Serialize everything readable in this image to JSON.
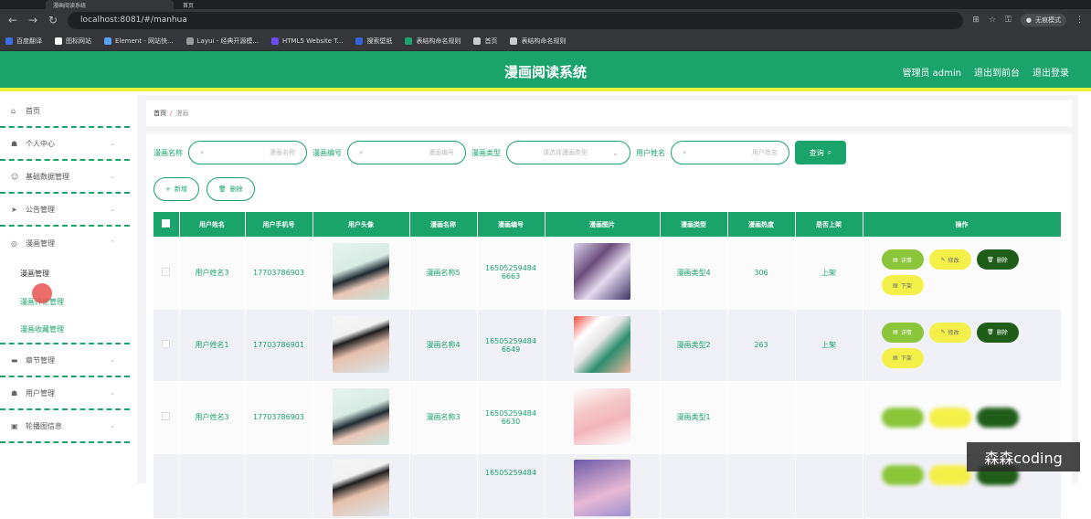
{
  "browser": {
    "tabs": [
      {
        "label": "漫画阅读系统"
      },
      {
        "label": "首页"
      }
    ],
    "url": "localhost:8081/#/manhua",
    "incognito_label": "无痕模式",
    "bookmarks": [
      {
        "label": "百度翻译",
        "color": "#3b6fe0"
      },
      {
        "label": "图标网站",
        "color": "#ffffff"
      },
      {
        "label": "Element - 网站快...",
        "color": "#5aa0f2"
      },
      {
        "label": "Layui - 经典开源模...",
        "color": "#999999"
      },
      {
        "label": "HTML5 Website T...",
        "color": "#6a4df2"
      },
      {
        "label": "搜索壁纸",
        "color": "#3563d8"
      },
      {
        "label": "表结构命名规则",
        "color": "#1aa36b"
      },
      {
        "label": "首页",
        "color": "#cccccc"
      },
      {
        "label": "表结构命名规则",
        "color": "#cccccc"
      }
    ]
  },
  "header": {
    "title": "漫画阅读系统",
    "admin_label": "管理员 admin",
    "backend_link": "退出到前台",
    "logout_link": "退出登录"
  },
  "sidebar": {
    "items": [
      {
        "label": "首页",
        "icon": "home-icon"
      },
      {
        "label": "个人中心",
        "icon": "user-icon"
      },
      {
        "label": "基础数据管理",
        "icon": "smile-icon"
      },
      {
        "label": "公告管理",
        "icon": "send-icon"
      },
      {
        "label": "漫画管理",
        "icon": "compass-icon"
      }
    ],
    "sub_items": [
      {
        "label": "漫画管理"
      },
      {
        "label": "漫画评论管理"
      },
      {
        "label": "漫画收藏管理"
      }
    ],
    "items_after": [
      {
        "label": "章节管理",
        "icon": "folder-icon"
      },
      {
        "label": "用户管理",
        "icon": "user-icon"
      },
      {
        "label": "轮播图信息",
        "icon": "image-icon"
      }
    ]
  },
  "breadcrumb": {
    "home": "首页",
    "separator": "/",
    "current": "漫画"
  },
  "search": {
    "name_label": "漫画名称",
    "name_placeholder": "漫画名称",
    "number_label": "漫画编号",
    "number_placeholder": "漫画编号",
    "type_label": "漫画类型",
    "type_placeholder": "请选择漫画类型",
    "user_label": "用户姓名",
    "user_placeholder": "用户姓名",
    "search_button": "查询"
  },
  "actions": {
    "add_button": "新增",
    "delete_button": "删除"
  },
  "table": {
    "columns": [
      "用户姓名",
      "用户手机号",
      "用户头像",
      "漫画名称",
      "漫画编号",
      "漫画图片",
      "漫画类型",
      "漫画热度",
      "是否上架",
      "操作"
    ],
    "rows": [
      {
        "user": "用户姓名3",
        "phone": "17703786903",
        "name": "漫画名称5",
        "number": "165052594846663",
        "type": "漫画类型4",
        "heat": "306",
        "status": "上架"
      },
      {
        "user": "用户姓名1",
        "phone": "17703786901",
        "name": "漫画名称4",
        "number": "165052594846649",
        "type": "漫画类型2",
        "heat": "263",
        "status": "上架"
      },
      {
        "user": "用户姓名3",
        "phone": "17703786903",
        "name": "漫画名称3",
        "number": "165052594846630",
        "type": "漫画类型1",
        "heat": "",
        "status": ""
      },
      {
        "user": "",
        "phone": "",
        "name": "",
        "number": "16505259484",
        "type": "",
        "heat": "",
        "status": ""
      }
    ],
    "op_detail": "详情",
    "op_edit": "修改",
    "op_delete": "删除",
    "op_down": "下架"
  },
  "watermark": "森森coding"
}
